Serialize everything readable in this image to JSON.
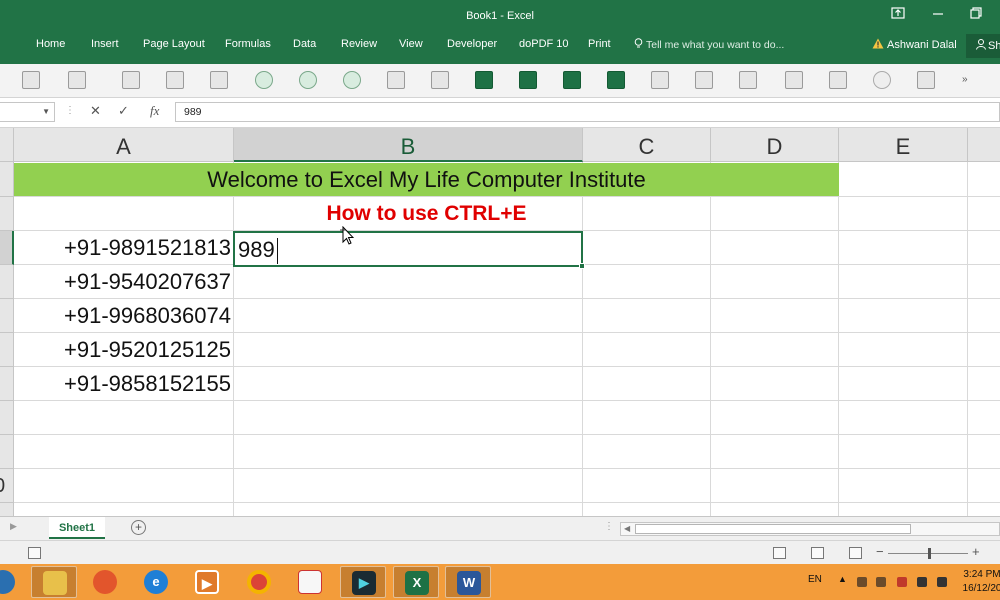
{
  "window": {
    "title": "Book1 - Excel"
  },
  "ribbon": {
    "tabs": [
      "Home",
      "Insert",
      "Page Layout",
      "Formulas",
      "Data",
      "Review",
      "View",
      "Developer",
      "doPDF 10",
      "Print"
    ],
    "tell_me": "Tell me what you want to do...",
    "user": "Ashwani Dalal",
    "share": "Sh"
  },
  "formula_bar": {
    "value": "989",
    "cancel_glyph": "✕",
    "enter_glyph": "✓",
    "fx": "fx"
  },
  "sheet": {
    "columns": [
      "A",
      "B",
      "C",
      "D",
      "E"
    ],
    "selected_column": "B",
    "title_cell": "Welcome to Excel My Life Computer Institute",
    "subtitle_cell": "How to use CTRL+E",
    "phones": [
      "+91-9891521813",
      "+91-9540207637",
      "+91-9968036074",
      "+91-9520125125",
      "+91-9858152155"
    ],
    "active_cell_input": "989",
    "row_number_partial": "0"
  },
  "sheet_tabs": {
    "tabs": [
      "Sheet1"
    ],
    "add_glyph": "+"
  },
  "taskbar": {
    "language": "EN",
    "time": "3:24 PM",
    "date": "16/12/20",
    "colors": {
      "taskbar": "#f39c3a",
      "excel": "#1e7145",
      "word": "#2b579a"
    }
  },
  "colors": {
    "excel_green": "#217346",
    "title_fill": "#92d050",
    "subtitle_text": "#e00000"
  }
}
